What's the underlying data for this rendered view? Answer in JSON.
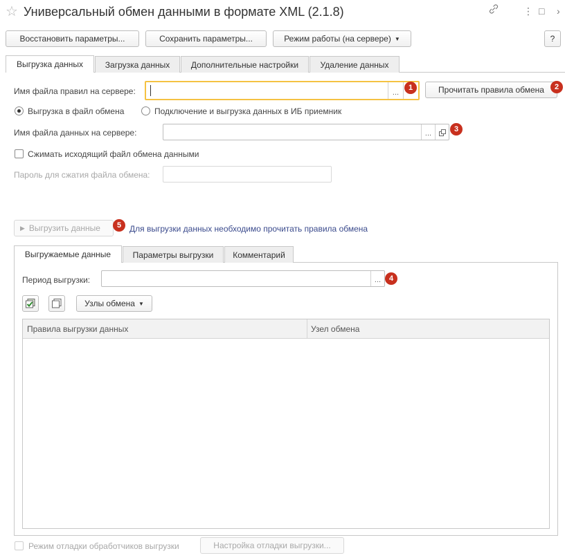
{
  "window": {
    "title": "Универсальный обмен данными в формате XML (2.1.8)",
    "star_icon": "☆",
    "link_icon": "🔗",
    "menu_icon": "⋮",
    "maximize_icon": "□",
    "close_icon": "›"
  },
  "toolbar": {
    "restore_label": "Восстановить параметры...",
    "save_label": "Сохранить параметры...",
    "mode_label": "Режим работы (на сервере)",
    "help_label": "?"
  },
  "tabs": [
    {
      "label": "Выгрузка данных",
      "active": true
    },
    {
      "label": "Загрузка данных",
      "active": false
    },
    {
      "label": "Дополнительные настройки",
      "active": false
    },
    {
      "label": "Удаление данных",
      "active": false
    }
  ],
  "export": {
    "rules_file_label": "Имя файла правил на сервере:",
    "rules_file_value": "",
    "read_rules_label": "Прочитать правила обмена",
    "radio_file_label": "Выгрузка в файл обмена",
    "radio_connect_label": "Подключение и выгрузка данных в ИБ приемник",
    "data_file_label": "Имя файла данных на сервере:",
    "data_file_value": "",
    "compress_label": "Сжимать исходящий файл обмена данными",
    "password_label": "Пароль для сжатия файла обмена:",
    "export_button_label": "Выгрузить данные",
    "hint_link": "Для выгрузки данных необходимо прочитать правила обмена"
  },
  "subtabs": [
    {
      "label": "Выгружаемые данные",
      "active": true
    },
    {
      "label": "Параметры выгрузки",
      "active": false
    },
    {
      "label": "Комментарий",
      "active": false
    }
  ],
  "period": {
    "label": "Период выгрузки:",
    "value": ""
  },
  "nodes_button_label": "Узлы обмена",
  "grid": {
    "columns": [
      "Правила выгрузки данных",
      "Узел обмена"
    ],
    "rows": []
  },
  "footer": {
    "debug_mode_label": "Режим отладки обработчиков выгрузки",
    "debug_settings_label": "Настройка отладки выгрузки..."
  },
  "badges": [
    "1",
    "2",
    "3",
    "4",
    "5"
  ],
  "colors": {
    "badge": "#c8301e",
    "focus": "#f5c242",
    "link": "#3a4a8c"
  }
}
